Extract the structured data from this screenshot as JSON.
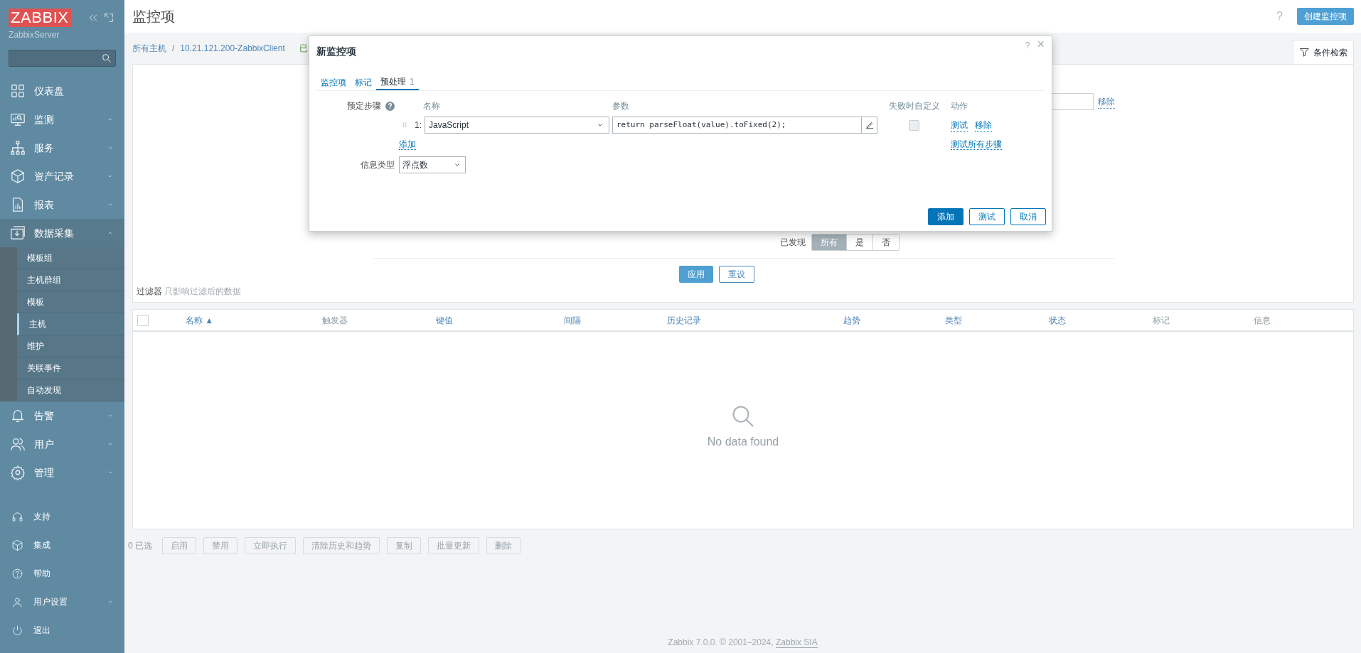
{
  "sidebar": {
    "logo": "ZABBIX",
    "server_name": "ZabbixServer",
    "menu": [
      {
        "label": "仪表盘",
        "kind": "link",
        "expanded": false
      },
      {
        "label": "监测",
        "kind": "group",
        "expanded": false
      },
      {
        "label": "服务",
        "kind": "group",
        "expanded": false
      },
      {
        "label": "资产记录",
        "kind": "group",
        "expanded": false
      },
      {
        "label": "报表",
        "kind": "group",
        "expanded": false
      },
      {
        "label": "数据采集",
        "kind": "group",
        "expanded": true,
        "children": [
          {
            "label": "模板组",
            "selected": false
          },
          {
            "label": "主机群组",
            "selected": false
          },
          {
            "label": "模板",
            "selected": false
          },
          {
            "label": "主机",
            "selected": true
          },
          {
            "label": "维护",
            "selected": false
          },
          {
            "label": "关联事件",
            "selected": false
          },
          {
            "label": "自动发现",
            "selected": false
          }
        ]
      },
      {
        "label": "告警",
        "kind": "group",
        "expanded": false
      },
      {
        "label": "用户",
        "kind": "group",
        "expanded": false
      },
      {
        "label": "管理",
        "kind": "group",
        "expanded": false
      }
    ],
    "bottom_menu": [
      {
        "label": "支持",
        "kind": "link"
      },
      {
        "label": "集成",
        "kind": "link"
      },
      {
        "label": "帮助",
        "kind": "link"
      },
      {
        "label": "用户设置",
        "kind": "group"
      },
      {
        "label": "退出",
        "kind": "link"
      }
    ]
  },
  "header": {
    "title": "监控项",
    "help": "?",
    "create_button": "创建监控项"
  },
  "breadcrumbs": [
    "所有主机",
    "10.21.121.200-ZabbixClient",
    "已"
  ],
  "breadcrumb_separator": "/",
  "filter_tab": "条件检索",
  "filter": {
    "remove_link": "移除",
    "discovered": {
      "label": "已发现",
      "options": [
        {
          "label": "所有",
          "selected": true
        },
        {
          "label": "是",
          "selected": false
        },
        {
          "label": "否",
          "selected": false
        }
      ]
    },
    "buttons": [
      {
        "label": "应用",
        "kind": "primary"
      },
      {
        "label": "重设",
        "kind": "secondary"
      }
    ],
    "note": {
      "label": "过滤器",
      "hint": "只影响过滤后的数据"
    }
  },
  "table": {
    "select_all": {
      "checked": false
    },
    "columns": [
      {
        "label": "名称",
        "sortable": true,
        "sort": "▲"
      },
      {
        "label": "触发器",
        "sortable": false
      },
      {
        "label": "键值",
        "sortable": true
      },
      {
        "label": "间隔",
        "sortable": true
      },
      {
        "label": "历史记录",
        "sortable": true
      },
      {
        "label": "趋势",
        "sortable": true
      },
      {
        "label": "类型",
        "sortable": true
      },
      {
        "label": "状态",
        "sortable": true
      },
      {
        "label": "标记",
        "sortable": false
      },
      {
        "label": "信息",
        "sortable": false
      }
    ],
    "empty_message": "No data found"
  },
  "selection": {
    "count": "0 已选",
    "buttons": [
      {
        "label": "启用",
        "disabled": true
      },
      {
        "label": "禁用",
        "disabled": true
      },
      {
        "label": "立即执行",
        "disabled": true
      },
      {
        "label": "清除历史和趋势",
        "disabled": true
      },
      {
        "label": "复制",
        "disabled": true
      },
      {
        "label": "批量更新",
        "disabled": true
      },
      {
        "label": "删除",
        "disabled": true
      }
    ]
  },
  "footer": {
    "text": "Zabbix 7.0.0. © 2001–2024, ",
    "link": "Zabbix SIA"
  },
  "dialog": {
    "title": "新监控项",
    "help": "?",
    "close": "×",
    "tabs": [
      {
        "label": "监控项",
        "selected": false
      },
      {
        "label": "标记",
        "selected": false
      },
      {
        "label": "预处理",
        "count": "1",
        "selected": true
      }
    ],
    "steps_label": "预定步骤",
    "steps_help": "?",
    "columns": [
      "名称",
      "参数",
      "失败时自定义",
      "动作"
    ],
    "steps": [
      {
        "number": "1:",
        "name": "JavaScript",
        "parameter": "return parseFloat(value).toFixed(2);",
        "custom_on_fail": false,
        "actions": [
          "测试",
          "移除"
        ]
      }
    ],
    "add_link": "添加",
    "test_all_link": "测试所有步骤",
    "info_type": {
      "label": "信息类型",
      "value": "浮点数"
    },
    "buttons": [
      {
        "label": "添加",
        "kind": "primary"
      },
      {
        "label": "测试",
        "kind": "secondary"
      },
      {
        "label": "取消",
        "kind": "secondary"
      }
    ]
  }
}
